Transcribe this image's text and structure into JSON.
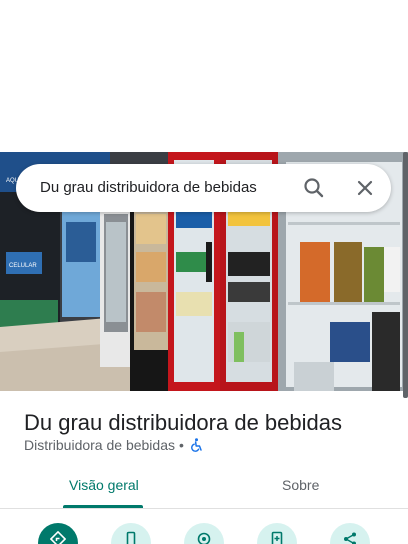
{
  "search": {
    "query": "Du grau distribuidora de bebidas"
  },
  "place": {
    "name": "Du grau distribuidora de bebidas",
    "category": "Distribuidora de bebidas",
    "separator": "•"
  },
  "tabs": [
    {
      "label": "Visão geral",
      "active": true
    },
    {
      "label": "Sobre",
      "active": false
    }
  ],
  "hero_signs": {
    "left_top": "AQUI",
    "left_mid": "CELULAR"
  },
  "actions": [
    {
      "icon": "directions-icon"
    },
    {
      "icon": "phone-icon"
    },
    {
      "icon": "location-icon"
    },
    {
      "icon": "save-icon"
    },
    {
      "icon": "share-icon"
    }
  ],
  "colors": {
    "accent": "#00796b",
    "accent_light": "#d6f2ef",
    "fridge_red": "#c4161c"
  }
}
